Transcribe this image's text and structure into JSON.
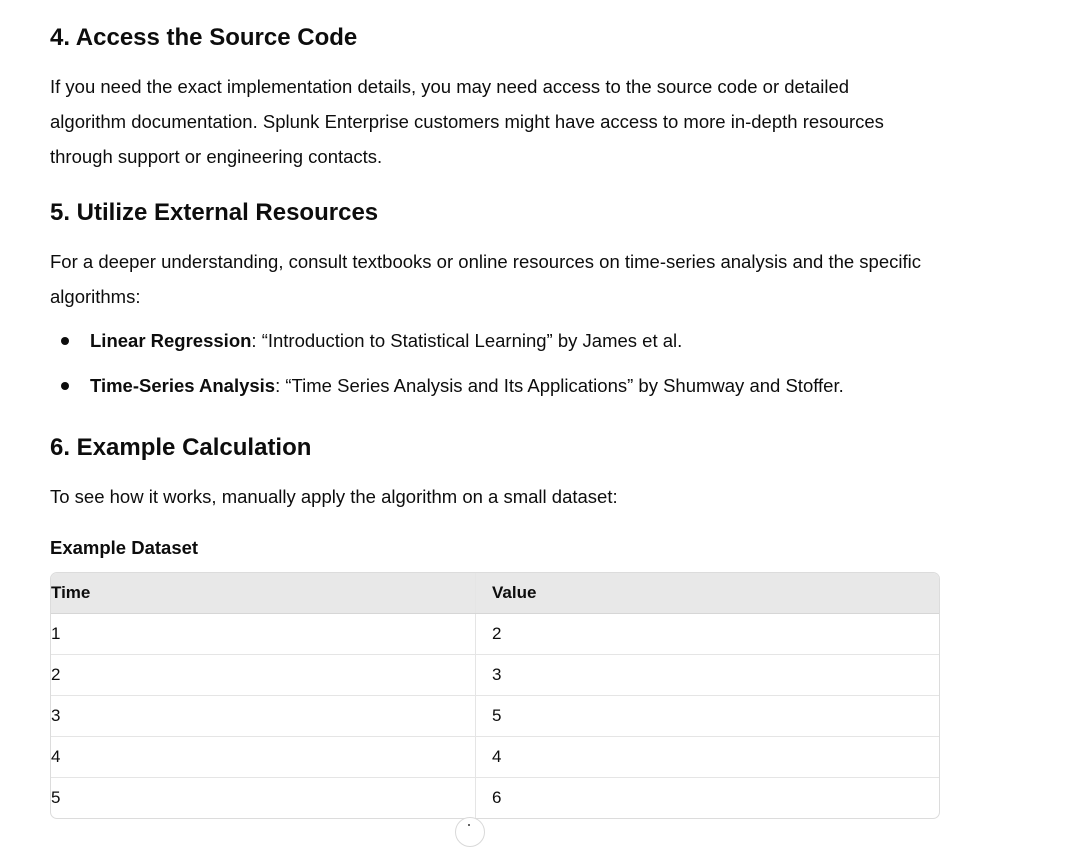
{
  "sections": {
    "s4": {
      "title": "4. Access the Source Code",
      "body": "If you need the exact implementation details, you may need access to the source code or detailed algorithm documentation. Splunk Enterprise customers might have access to more in-depth resources through support or engineering contacts."
    },
    "s5": {
      "title": "5. Utilize External Resources",
      "body": "For a deeper understanding, consult textbooks or online resources on time-series analysis and the specific algorithms:",
      "refs": [
        {
          "term": "Linear Regression",
          "text": ": “Introduction to Statistical Learning” by James et al."
        },
        {
          "term": "Time-Series Analysis",
          "text": ": “Time Series Analysis and Its Applications” by Shumway and Stoffer."
        }
      ]
    },
    "s6": {
      "title": "6. Example Calculation",
      "body": "To see how it works, manually apply the algorithm on a small dataset:",
      "subheading": "Example Dataset",
      "table": {
        "headers": [
          "Time",
          "Value"
        ],
        "rows": [
          [
            "1",
            "2"
          ],
          [
            "2",
            "3"
          ],
          [
            "3",
            "5"
          ],
          [
            "4",
            "4"
          ],
          [
            "5",
            "6"
          ]
        ]
      }
    }
  }
}
